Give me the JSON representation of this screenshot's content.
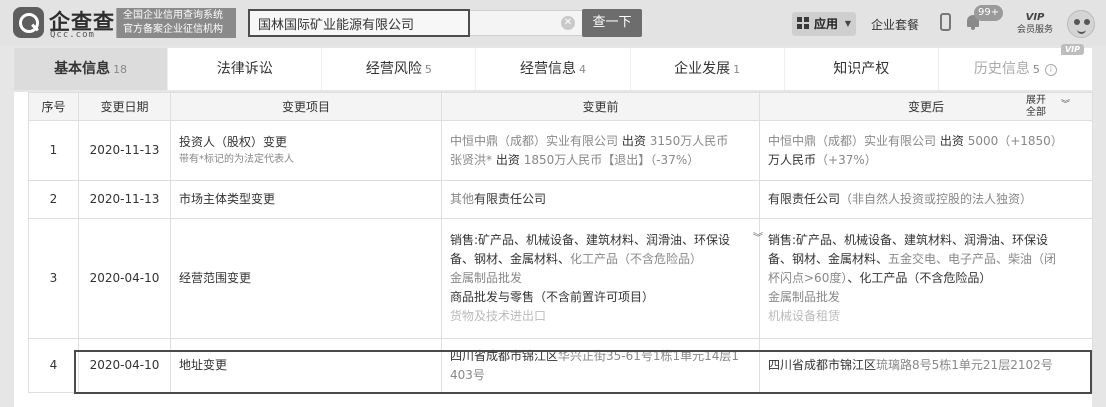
{
  "header": {
    "logo_name": "企查查",
    "logo_sub": "Qcc.com",
    "slogan_line1": "全国企业信用查询系统",
    "slogan_line2": "官方备案企业征信机构",
    "search_value": "国林国际矿业能源有限公司",
    "search_button": "查一下",
    "apps_label": "应用",
    "suite_label": "企业套餐",
    "notify_badge": "99+",
    "vip_top": "VIP",
    "vip_sub": "会员服务"
  },
  "tabs": [
    {
      "label": "基本信息",
      "count": "18"
    },
    {
      "label": "法律诉讼",
      "count": ""
    },
    {
      "label": "经营风险",
      "count": "5"
    },
    {
      "label": "经营信息",
      "count": "4"
    },
    {
      "label": "企业发展",
      "count": "1"
    },
    {
      "label": "知识产权",
      "count": ""
    },
    {
      "label": "历史信息",
      "count": "5",
      "vip_tag": "VIP"
    }
  ],
  "table": {
    "headers": {
      "index": "序号",
      "date": "变更日期",
      "item": "变更项目",
      "before": "变更前",
      "after": "变更后",
      "expand_line1": "展开",
      "expand_line2": "全部"
    },
    "rows": [
      {
        "index": "1",
        "date": "2020-11-13",
        "item": "投资人（股权）变更",
        "item_note": "带有*标记的为法定代表人",
        "before_1a": "中恒中鼎（成都）实业有限公司",
        "before_1b": "出资",
        "before_1c": "3150万人民币",
        "before_2a": "张贤洪*",
        "before_2b": "出资",
        "before_2c": "1850万人民币【退出】（-37%）",
        "after_1a": "中恒中鼎（成都）实业有限公司",
        "after_1b": "出资",
        "after_1c": "5000（+1850）",
        "after_2a": "万人民币",
        "after_2b": "（+37%）"
      },
      {
        "index": "2",
        "date": "2020-11-13",
        "item": "市场主体类型变更",
        "before_a": "其他",
        "before_b": "有限责任公司",
        "after_a": "有限责任公司",
        "after_b": "（非自然人投资或控股的法人独资）"
      },
      {
        "index": "3",
        "date": "2020-04-10",
        "item": "经营范围变更",
        "before_l1": "销售:矿产品、机械设备、建筑材料、润滑油、环保设",
        "before_l2a": "备、钢材、金属材料、",
        "before_l2b": "化工产品（不含危险品）",
        "before_l3": "金属制品批发",
        "before_l4": "商品批发与零售（不含前置许可项目）",
        "before_l5": "货物及技术进出口",
        "after_l1": "销售:矿产品、机械设备、建筑材料、润滑油、环保设",
        "after_l2a": "备、钢材、金属材料、",
        "after_l2b": "五金交电、电子产品、柴油（闭",
        "after_l3a": "杯闪点>60度）",
        "after_l3b": "、化工产品（不含危险品）",
        "after_l4": "金属制品批发",
        "after_l5": "机械设备租赁"
      },
      {
        "index": "4",
        "date": "2020-04-10",
        "item": "地址变更",
        "before_a": "四川省成都市锦江区",
        "before_b": "华兴正街35-61号1栋1单元14层1",
        "before_c": "403号",
        "after_a": "四川省成都市锦江区",
        "after_b": "琉璃路8号5栋1单元21层2102号"
      }
    ]
  }
}
